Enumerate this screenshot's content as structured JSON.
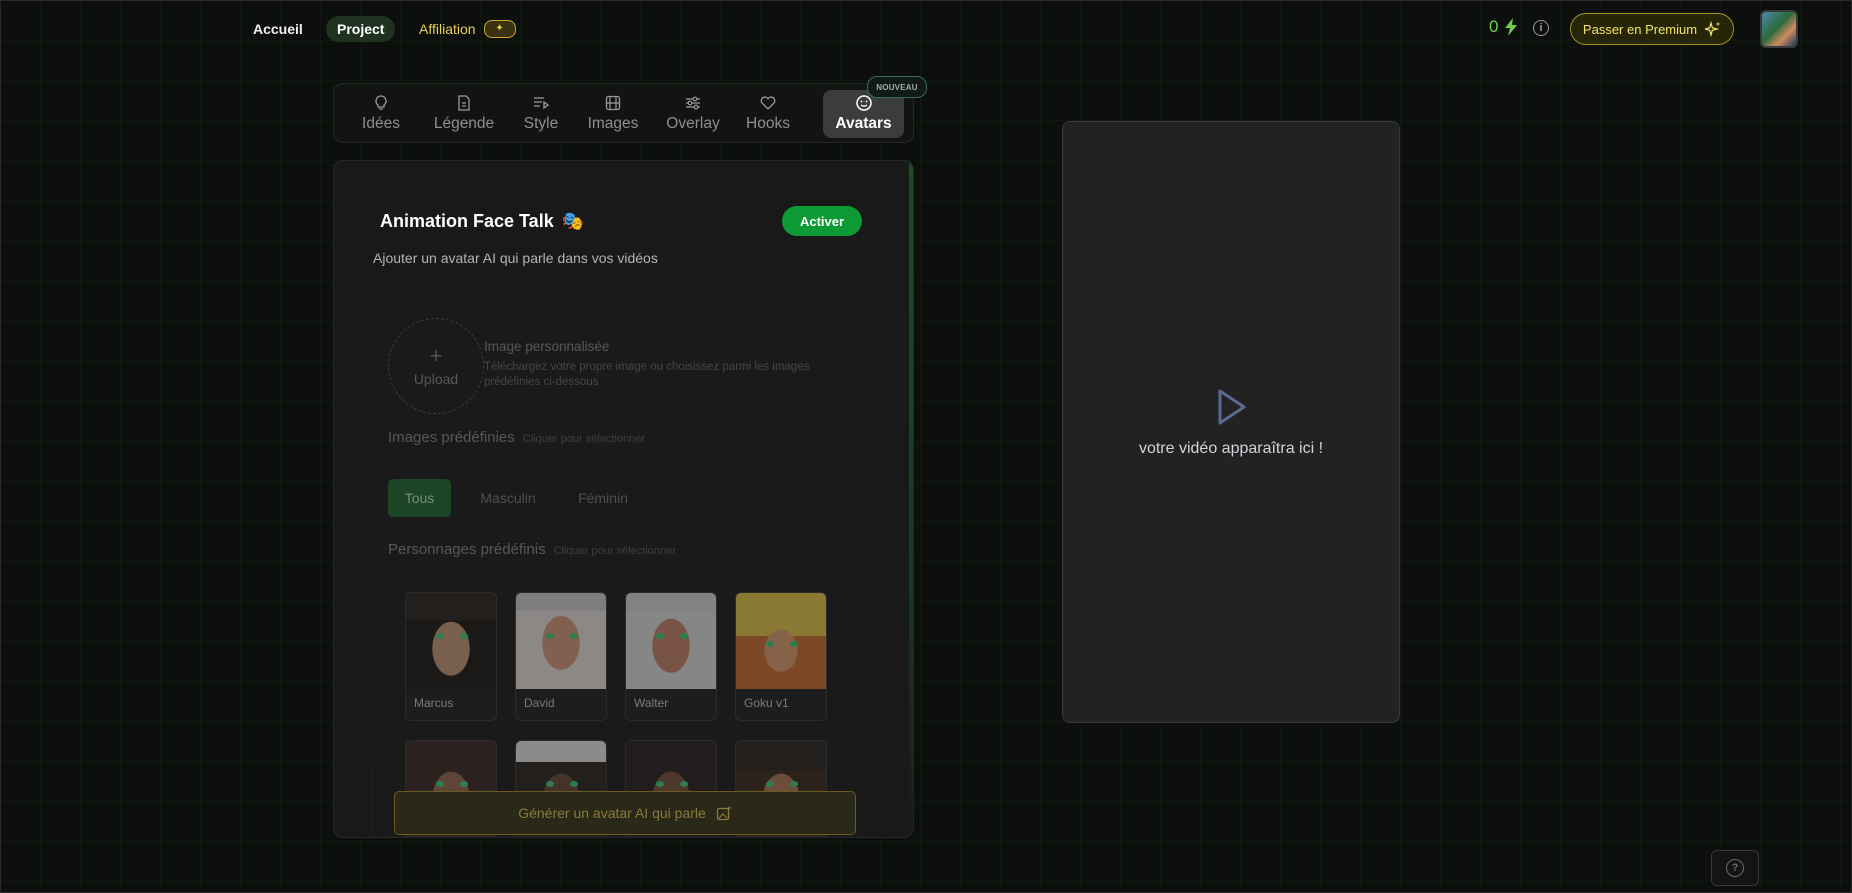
{
  "nav": {
    "accueil": "Accueil",
    "project": "Project",
    "affiliation": "Affiliation",
    "affiliation_badge_icon": "sparkle-icon"
  },
  "header": {
    "credits": "0",
    "credits_icon": "lightning-icon",
    "info_icon": "info-icon",
    "premium_label": "Passer en Premium",
    "premium_icon": "sparkles-icon",
    "profile_icon": "user-avatar"
  },
  "tabs": [
    {
      "label": "Idées",
      "icon": "lightbulb-icon"
    },
    {
      "label": "Légende",
      "icon": "document-icon"
    },
    {
      "label": "Style",
      "icon": "text-style-icon"
    },
    {
      "label": "Images",
      "icon": "film-icon"
    },
    {
      "label": "Overlay",
      "icon": "sliders-icon"
    },
    {
      "label": "Hooks",
      "icon": "heart-icon"
    },
    {
      "label": "Avatars",
      "icon": "smiley-icon",
      "badge": "NOUVEAU",
      "active": true
    }
  ],
  "panel": {
    "title": "Animation Face Talk",
    "title_emoji": "🎭",
    "activate_label": "Activer",
    "subtitle": "Ajouter un avatar AI qui parle dans vos vidéos",
    "upload_label": "Upload",
    "custom_title": "Image personnalisée",
    "custom_desc": "Téléchargez votre propre image ou choisissez parmi les images prédéfinies ci-dessous",
    "predef_images_title": "Images prédéfinies",
    "predef_images_hint": "Cliquer pour sélectionner",
    "filters": [
      "Tous",
      "Masculin",
      "Féminin"
    ],
    "predef_chars_title": "Personnages prédéfinis",
    "predef_chars_hint": "Cliquer pour sélectionner",
    "characters": [
      "Marcus",
      "David",
      "Walter",
      "Goku v1"
    ],
    "generate_label": "Générer un avatar AI qui parle",
    "generate_icon": "image-sparkle-icon"
  },
  "preview": {
    "placeholder": "votre vidéo apparaîtra ici !",
    "play_icon": "play-icon"
  },
  "help_icon": "help-icon",
  "colors": {
    "accent_green": "#0d9a35",
    "credits_green": "#6ed04a",
    "premium_gold": "#f2e46a",
    "affiliation_gold": "#e8cf5a"
  }
}
